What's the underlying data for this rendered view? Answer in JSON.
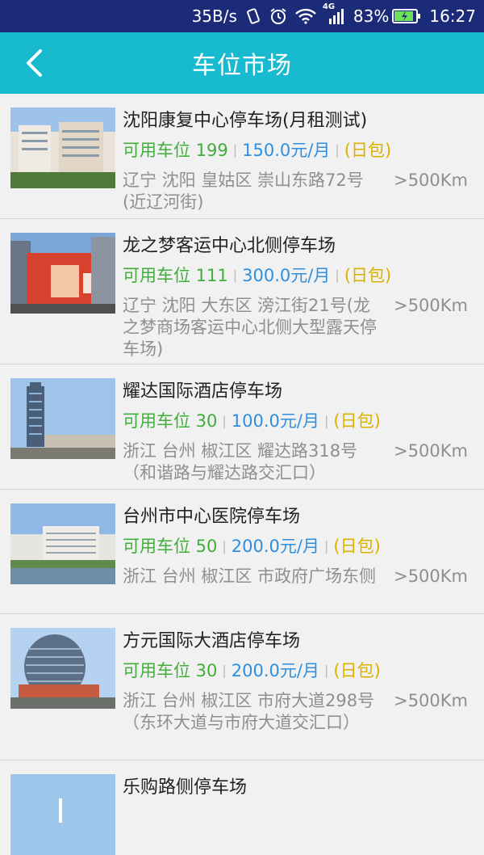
{
  "status": {
    "speed": "35B/s",
    "network": "4G",
    "battery": "83%",
    "time": "16:27"
  },
  "header": {
    "title": "车位市场"
  },
  "lots": [
    {
      "name": "沈阳康复中心停车场(月租测试)",
      "available": "可用车位 199",
      "price": "150.0元/月",
      "package": "(日包)",
      "address": "辽宁 沈阳 皇姑区 崇山东路72号(近辽河街)",
      "distance": ">500Km"
    },
    {
      "name": "龙之梦客运中心北侧停车场",
      "available": "可用车位 111",
      "price": "300.0元/月",
      "package": "(日包)",
      "address": "辽宁 沈阳 大东区 滂江街21号(龙之梦商场客运中心北侧大型露天停车场)",
      "distance": ">500Km"
    },
    {
      "name": "耀达国际酒店停车场",
      "available": "可用车位 30",
      "price": "100.0元/月",
      "package": "(日包)",
      "address": "浙江 台州 椒江区 耀达路318号（和谐路与耀达路交汇口）",
      "distance": ">500Km"
    },
    {
      "name": "台州市中心医院停车场",
      "available": "可用车位 50",
      "price": "200.0元/月",
      "package": "(日包)",
      "address": "浙江 台州 椒江区 市政府广场东侧",
      "distance": ">500Km"
    },
    {
      "name": "方元国际大酒店停车场",
      "available": "可用车位 30",
      "price": "200.0元/月",
      "package": "(日包)",
      "address": "浙江 台州 椒江区 市府大道298号（东环大道与市府大道交汇口）",
      "distance": ">500Km"
    },
    {
      "name": "乐购路侧停车场"
    }
  ]
}
